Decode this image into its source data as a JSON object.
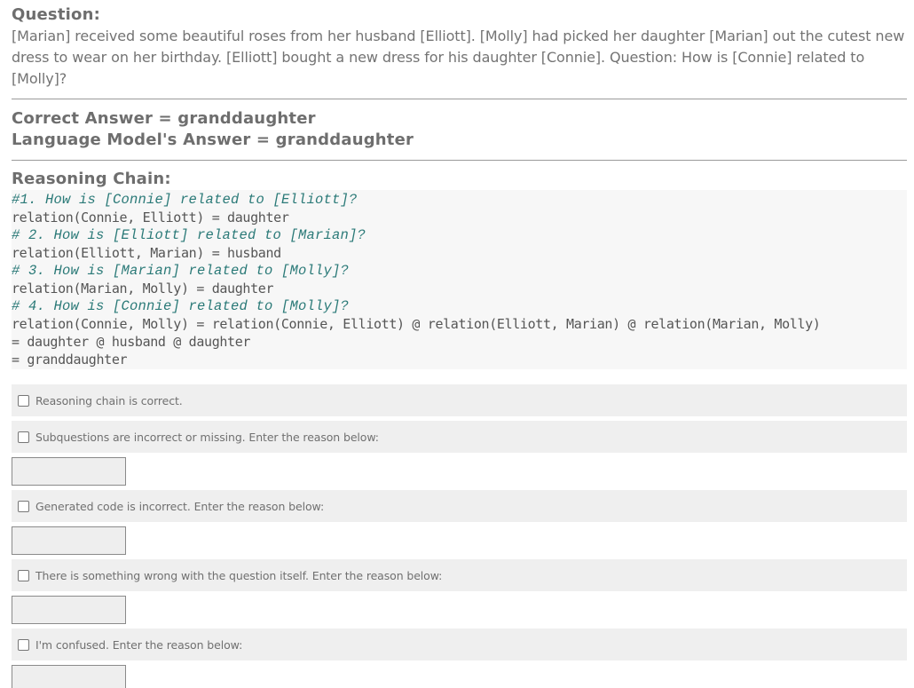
{
  "question": {
    "label": "Question:",
    "text": "[Marian] received some beautiful roses from her husband [Elliott]. [Molly] had picked her daughter [Marian] out the cutest new dress to wear on her birthday. [Elliott] bought a new dress for his daughter [Connie]. Question: How is [Connie] related to [Molly]?"
  },
  "answers": {
    "correct": "Correct Answer = granddaughter",
    "model": "Language Model's Answer = granddaughter"
  },
  "reasoning": {
    "label": "Reasoning Chain:",
    "lines": [
      {
        "text": "#1. How is [Connie] related to [Elliott]?",
        "kind": "comment"
      },
      {
        "text": "relation(Connie, Elliott) = daughter",
        "kind": "code"
      },
      {
        "text": "# 2. How is [Elliott] related to [Marian]?",
        "kind": "comment"
      },
      {
        "text": "relation(Elliott, Marian) = husband",
        "kind": "code"
      },
      {
        "text": "# 3. How is [Marian] related to [Molly]?",
        "kind": "comment"
      },
      {
        "text": "relation(Marian, Molly) = daughter",
        "kind": "code"
      },
      {
        "text": "# 4. How is [Connie] related to [Molly]?",
        "kind": "comment"
      },
      {
        "text": "relation(Connie, Molly) = relation(Connie, Elliott) @ relation(Elliott, Marian) @ relation(Marian, Molly)",
        "kind": "code"
      },
      {
        "text": "= daughter @ husband @ daughter",
        "kind": "code"
      },
      {
        "text": "= granddaughter",
        "kind": "code"
      }
    ]
  },
  "options": [
    {
      "label": "Reasoning chain is correct.",
      "checked": false,
      "has_input": false,
      "input_value": ""
    },
    {
      "label": "Subquestions are incorrect or missing. Enter the reason below:",
      "checked": false,
      "has_input": true,
      "input_value": ""
    },
    {
      "label": "Generated code is incorrect. Enter the reason below:",
      "checked": false,
      "has_input": true,
      "input_value": ""
    },
    {
      "label": "There is something wrong with the question itself. Enter the reason below:",
      "checked": false,
      "has_input": true,
      "input_value": ""
    },
    {
      "label": "I'm confused. Enter the reason below:",
      "checked": false,
      "has_input": true,
      "input_value": ""
    }
  ],
  "colors": {
    "comment": "#2b7a78",
    "option_bg": "#efefef",
    "code_bg": "#f7f7f7"
  }
}
